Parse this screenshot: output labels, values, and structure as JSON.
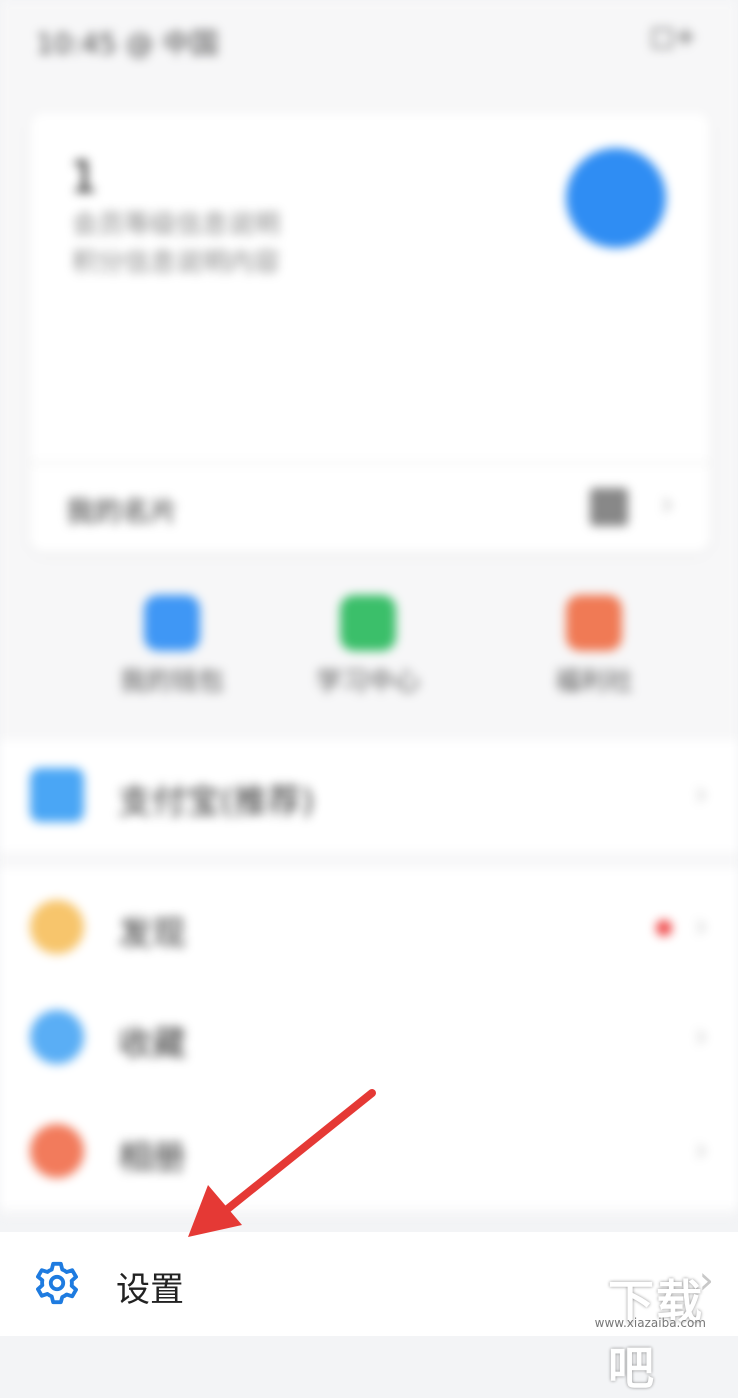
{
  "status_bar": {
    "time": "10:45 @ 中国",
    "battery": "□+"
  },
  "profile": {
    "name": "1",
    "line1": "会员等级信息说明",
    "line2": "积分信息说明内容",
    "card_link": "我的名片",
    "avatar_color": "#2f8df3"
  },
  "quick_actions": [
    {
      "label": "我的钱包",
      "color": "#3f97f5"
    },
    {
      "label": "学习中心",
      "color": "#3bbf6a"
    },
    {
      "label": "福利社",
      "color": "#f07a55"
    }
  ],
  "list_section_1": [
    {
      "label": "支付宝(推荐)",
      "icon": "wallet-icon",
      "color": "#4aa6f5"
    }
  ],
  "list_section_2": [
    {
      "label": "发现",
      "icon": "star-icon",
      "color": "#f7c56c",
      "badge": "dot"
    },
    {
      "label": "收藏",
      "icon": "folder-icon",
      "color": "#5aaef5"
    },
    {
      "label": "相册",
      "icon": "photo-icon",
      "color": "#f27b5c"
    }
  ],
  "settings": {
    "label": "设置",
    "icon": "gear-icon",
    "accent": "#1e7be0"
  },
  "annotation_arrow": {
    "color": "#e53935"
  },
  "watermark": {
    "text": "下载吧",
    "sub": "www.xiazaiba.com"
  }
}
